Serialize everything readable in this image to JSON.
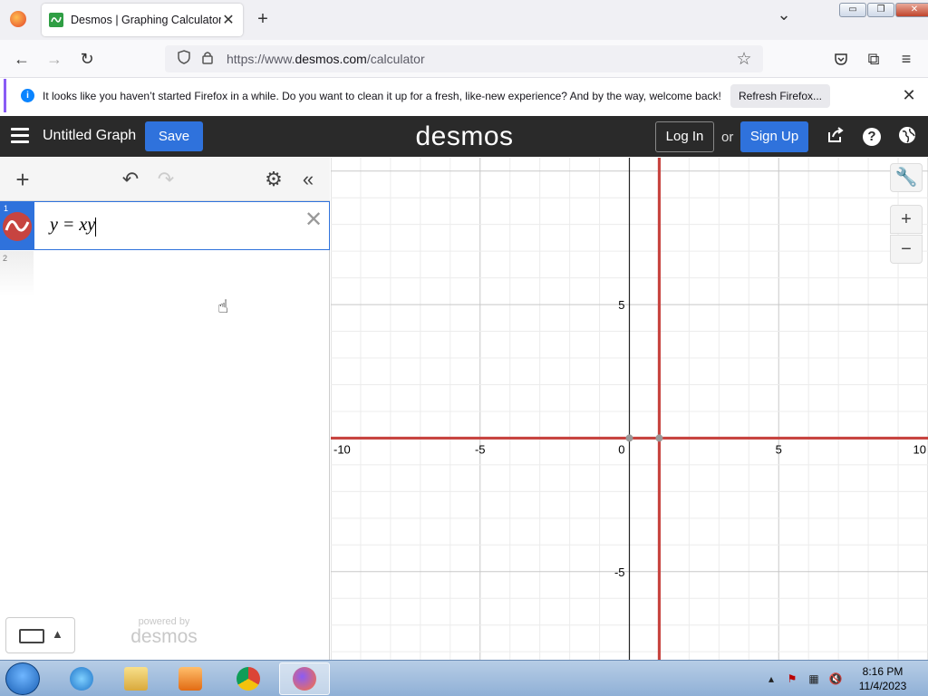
{
  "browser": {
    "tab_title": "Desmos | Graphing Calculator",
    "tab_close": "✕",
    "new_tab": "+",
    "tab_list": "⌄",
    "url_prefix": "https://www.",
    "url_domain": "desmos.com",
    "url_path": "/calculator",
    "window_controls": [
      "▭",
      "❐",
      "✕"
    ]
  },
  "notification": {
    "message": "It looks like you haven’t started Firefox in a while. Do you want to clean it up for a fresh, like-new experience? And by the way, welcome back!",
    "button_label": "Refresh Firefox...",
    "close": "✕"
  },
  "desmos": {
    "graph_title": "Untitled Graph",
    "save_label": "Save",
    "logo": "desmos",
    "login_label": "Log In",
    "or_label": "or",
    "signup_label": "Sign Up"
  },
  "expressions": [
    {
      "index": "1",
      "latex": "y = xy",
      "color": "#c74440"
    },
    {
      "index": "2",
      "latex": ""
    }
  ],
  "expression_panel": {
    "powered_by": "powered by",
    "powered_logo": "desmos"
  },
  "graph": {
    "x_range": [
      -10,
      10
    ],
    "y_range": [
      -8.3,
      10.5
    ],
    "grid_step": 1,
    "label_step": 5,
    "x_tick_labels": [
      "-10",
      "-5",
      "0",
      "5",
      "10"
    ],
    "y_tick_labels": [
      "5",
      "-5"
    ],
    "curve_color": "#c74440",
    "curve_lines": [
      {
        "kind": "horizontal",
        "y": 0
      },
      {
        "kind": "vertical",
        "x": 1
      }
    ],
    "zoom_in": "+",
    "zoom_out": "−"
  },
  "taskbar": {
    "time": "8:16 PM",
    "date": "11/4/2023"
  }
}
